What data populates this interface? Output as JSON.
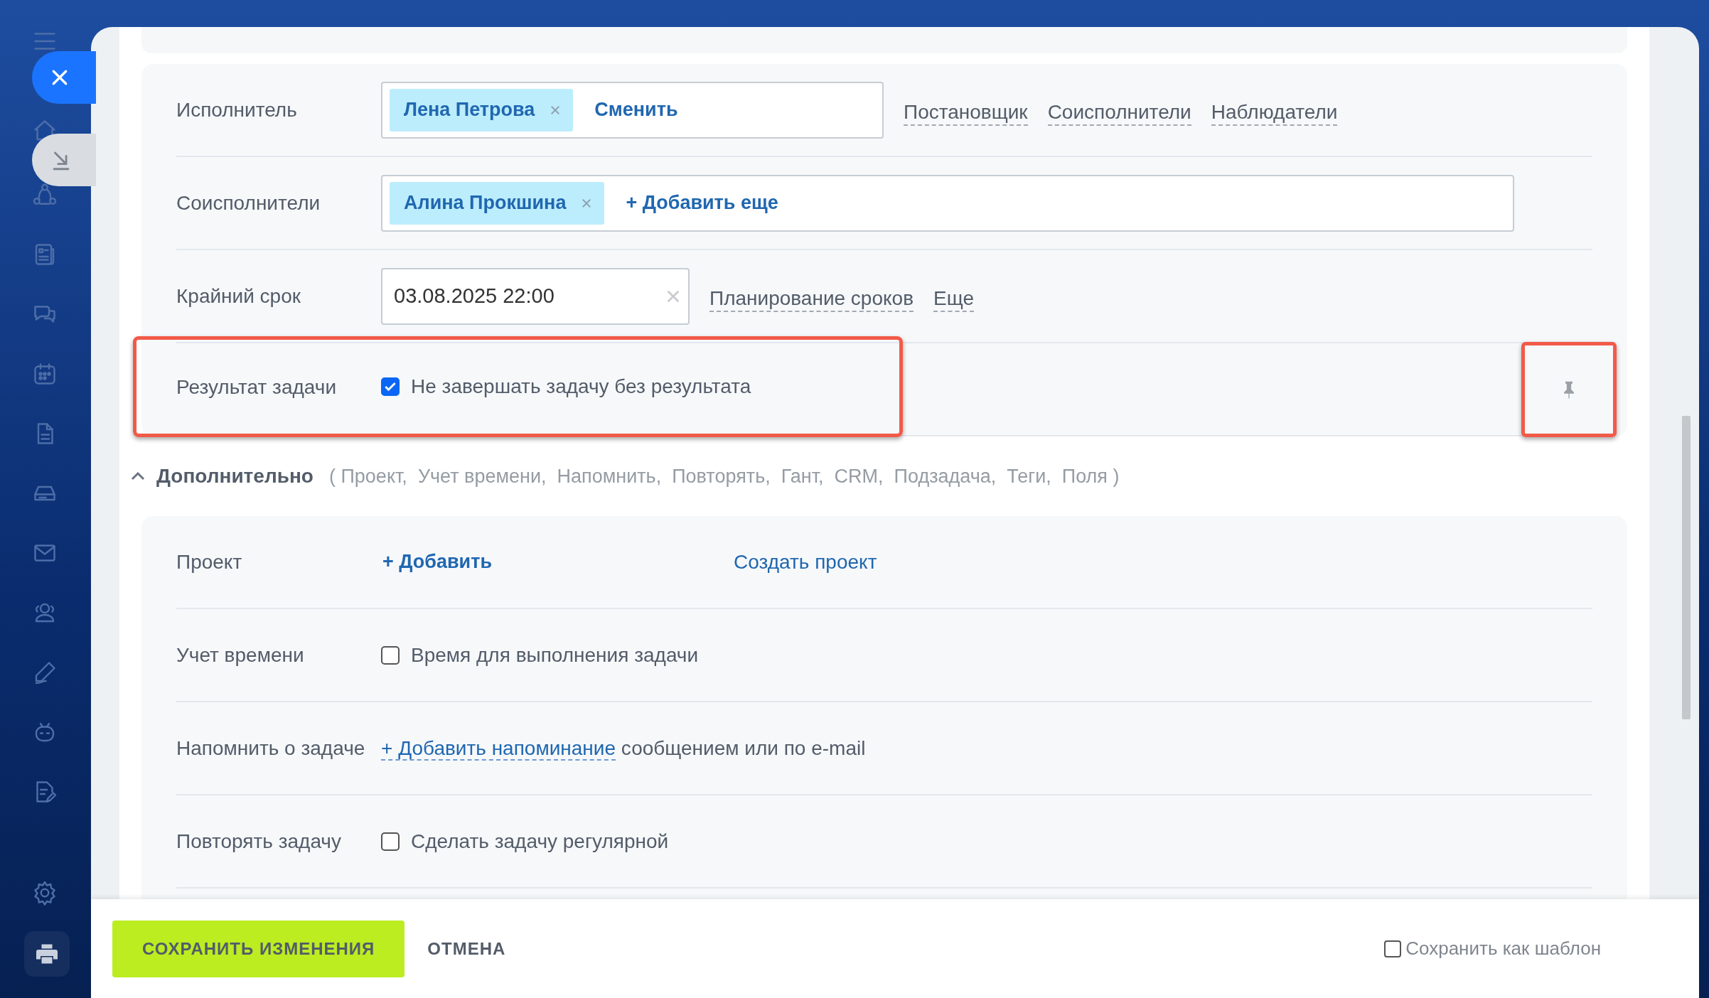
{
  "main_rows": [
    {
      "kind": "people",
      "label": "Исполнитель",
      "chips": [
        "Лена Петрова"
      ],
      "action": "Сменить",
      "links": [
        "Постановщик",
        "Соисполнители",
        "Наблюдатели"
      ]
    },
    {
      "kind": "people",
      "label": "Соисполнители",
      "chips": [
        "Алина Прокшина"
      ],
      "action": "+ Добавить еще"
    },
    {
      "kind": "date",
      "label": "Крайний срок",
      "value": "03.08.2025 22:00",
      "links": [
        "Планирование сроков",
        "Еще"
      ]
    },
    {
      "kind": "checkbox",
      "label": "Результат задачи",
      "text": "Не завершать задачу без результата",
      "checked": true,
      "highlighted": true,
      "pin_highlighted": true
    }
  ],
  "extra": {
    "title": "Дополнительно",
    "expanded": true,
    "summary": "( Проект,  Учет времени,  Напомнить,  Повторять,  Гант,  CRM,  Подзадача,  Теги,  Поля )",
    "rows": [
      {
        "kind": "project",
        "label": "Проект",
        "button": "+ Добавить",
        "link": "Создать проект"
      },
      {
        "kind": "checkbox",
        "label": "Учет времени",
        "text": "Время для выполнения задачи",
        "checked": false
      },
      {
        "kind": "reminder",
        "label": "Напомнить о задаче",
        "link": "+ Добавить напоминание",
        "text": "сообщением или по e-mail"
      },
      {
        "kind": "checkbox",
        "label": "Повторять задачу",
        "text": "Сделать задачу регулярной",
        "checked": false
      }
    ]
  },
  "footer": {
    "save": "СОХРАНИТЬ ИЗМЕНЕНИЯ",
    "cancel": "ОТМЕНА",
    "template": {
      "label": "Сохранить как шаблон",
      "checked": false
    }
  }
}
